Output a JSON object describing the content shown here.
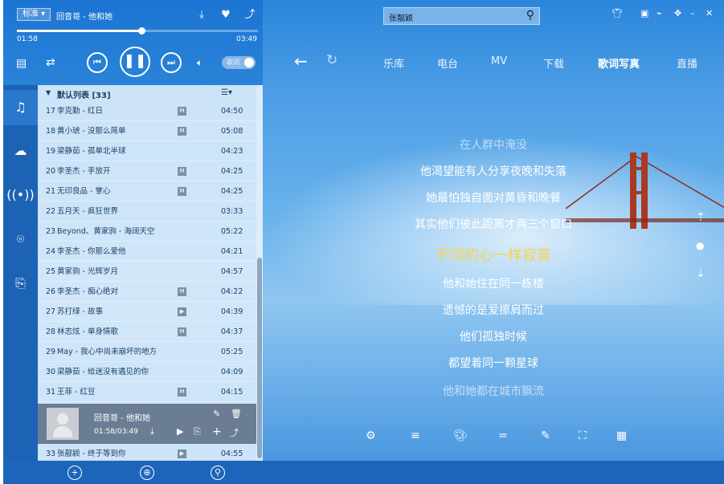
{
  "player": {
    "quality": "标准 ▾",
    "now_title": "回音哥 - 他和她",
    "time_current": "01:58",
    "time_total": "03:49",
    "progress": 0.515,
    "lyrics_toggle": "歌词"
  },
  "sidebar": {
    "icons": [
      "music-icon",
      "cloud-icon",
      "radio-icon",
      "location-icon",
      "share-icon"
    ]
  },
  "playlist": {
    "title": "默认列表",
    "count": "[33]",
    "menu": "☰▾",
    "rows": [
      {
        "num": "17",
        "song": "李克勤 - 红日",
        "mv": "M",
        "dur": "04:50"
      },
      {
        "num": "18",
        "song": "黄小琥 - 没那么简单",
        "mv": "M",
        "dur": "05:08"
      },
      {
        "num": "19",
        "song": "梁静茹 - 孤单北半球",
        "mv": "",
        "dur": "04:23"
      },
      {
        "num": "20",
        "song": "李圣杰 - 手放开",
        "mv": "M",
        "dur": "04:25"
      },
      {
        "num": "21",
        "song": "无印良品 - 掌心",
        "mv": "M",
        "dur": "04:25"
      },
      {
        "num": "22",
        "song": "五月天 - 疯狂世界",
        "mv": "",
        "dur": "03:33"
      },
      {
        "num": "23",
        "song": "Beyond、黄家驹 - 海阔天空",
        "mv": "",
        "dur": "05:22"
      },
      {
        "num": "24",
        "song": "李圣杰 - 你那么爱他",
        "mv": "",
        "dur": "04:21"
      },
      {
        "num": "25",
        "song": "黄家驹 - 光辉岁月",
        "mv": "",
        "dur": "04:57"
      },
      {
        "num": "26",
        "song": "李圣杰 - 痴心绝对",
        "mv": "M",
        "dur": "04:22"
      },
      {
        "num": "27",
        "song": "苏打绿 - 故事",
        "mv": "▶",
        "dur": "04:39"
      },
      {
        "num": "28",
        "song": "林志炫 - 单身情歌",
        "mv": "M",
        "dur": "04:37"
      },
      {
        "num": "29",
        "song": "May - 我心中尚未崩坏的地方",
        "mv": "",
        "dur": "05:25"
      },
      {
        "num": "30",
        "song": "梁静茹 - 给迷没有遇见的你",
        "mv": "",
        "dur": "04:09"
      },
      {
        "num": "31",
        "song": "王菲 - 红豆",
        "mv": "M",
        "dur": "04:15"
      }
    ],
    "current": {
      "title": "回音哥 - 他和她",
      "time": "01:58/03:49"
    },
    "last_row": {
      "num": "33",
      "song": "张靓颖 - 终于等到你",
      "mv": "▶",
      "dur": "04:55"
    }
  },
  "search": {
    "value": "张靓颖"
  },
  "tabs": [
    "乐库",
    "电台",
    "MV",
    "下载",
    "歌词写真",
    "直播"
  ],
  "lyrics": [
    "在人群中淹没",
    "他渴望能有人分享夜晚和失落",
    "她最怕独自面对黄昏和晚餐",
    "其实他们彼此距离才两三个窗口",
    "不同的心一样寂寞",
    "他和她住在同一栋楼",
    "遗憾的是爱擦肩而过",
    "他们孤独时候",
    "都望着同一颗星球",
    "他和她都在城市飘流"
  ]
}
